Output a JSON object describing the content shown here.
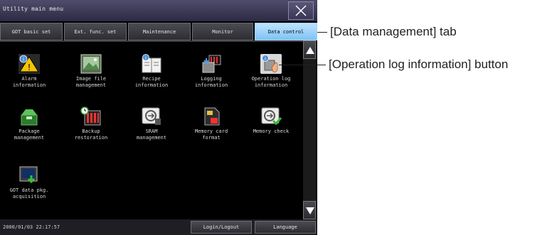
{
  "title": "Utility main menu",
  "tabs": [
    {
      "label": "GOT basic set",
      "active": false
    },
    {
      "label": "Ext. func. set",
      "active": false
    },
    {
      "label": "Maintenance",
      "active": false
    },
    {
      "label": "Monitor",
      "active": false
    },
    {
      "label": "Data control",
      "active": true
    }
  ],
  "items": [
    {
      "label": "Alarm\ninformation",
      "icon": "alarm-warning-icon"
    },
    {
      "label": "Image file\nmanagement",
      "icon": "image-file-icon"
    },
    {
      "label": "Recipe\ninformation",
      "icon": "recipe-book-icon"
    },
    {
      "label": "Logging\ninformation",
      "icon": "logging-icon"
    },
    {
      "label": "Operation log\ninformation",
      "icon": "operation-log-icon"
    },
    {
      "label": "Package\nmanagement",
      "icon": "package-icon"
    },
    {
      "label": "Backup\nrestoration",
      "icon": "backup-restore-icon"
    },
    {
      "label": "SRAM\nmanagement",
      "icon": "sram-icon"
    },
    {
      "label": "Memory card\nformat",
      "icon": "memory-card-icon"
    },
    {
      "label": "Memory check",
      "icon": "memory-check-icon"
    },
    {
      "label": "GOT data pkg.\nacquisition",
      "icon": "got-data-acquisition-icon"
    }
  ],
  "status": {
    "datetime": "2000/01/03 22:17:57",
    "login_label": "Login/Logout",
    "language_label": "Language"
  },
  "callouts": {
    "tab": "[Data management] tab",
    "button": "[Operation log information] button"
  },
  "colors": {
    "active_tab": "#8ecbf7",
    "titlebar": "#3b3856",
    "background": "#000000"
  }
}
